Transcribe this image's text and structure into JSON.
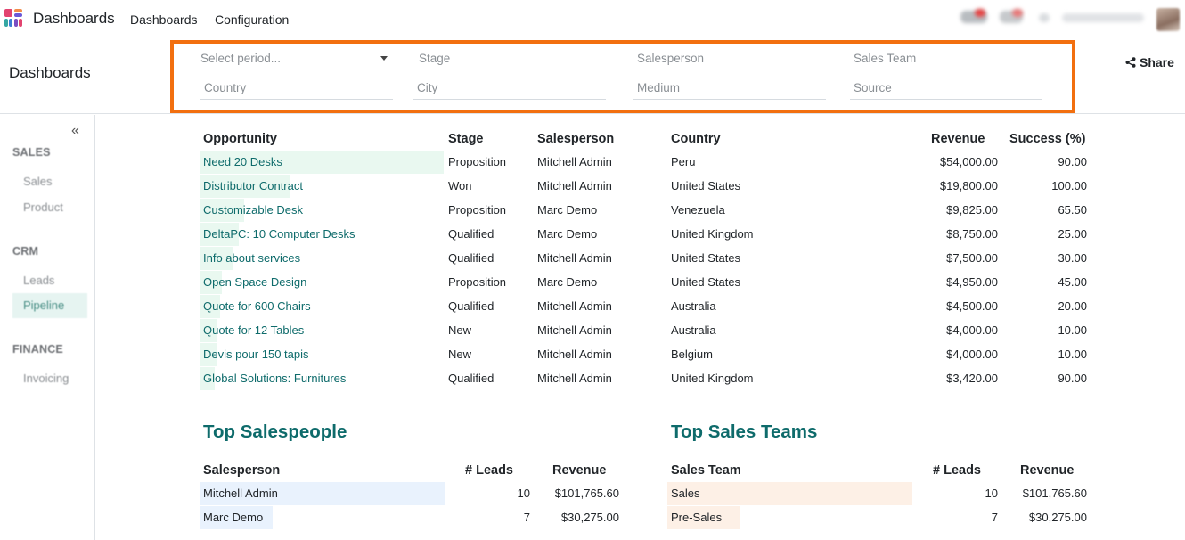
{
  "navbar": {
    "app_name": "Dashboards",
    "menus": [
      "Dashboards",
      "Configuration"
    ]
  },
  "control_panel": {
    "title": "Dashboards",
    "filters": {
      "period": "Select period...",
      "stage": "Stage",
      "salesperson": "Salesperson",
      "sales_team": "Sales Team",
      "country": "Country",
      "city": "City",
      "medium": "Medium",
      "source": "Source"
    },
    "share_label": "Share"
  },
  "sidebar": {
    "sections": [
      {
        "heading": "SALES",
        "items": [
          "Sales",
          "Product"
        ]
      },
      {
        "heading": "CRM",
        "items": [
          "Leads",
          "Pipeline"
        ]
      },
      {
        "heading": "FINANCE",
        "items": [
          "Invoicing"
        ]
      }
    ],
    "active_item": "Pipeline"
  },
  "opportunities": {
    "headers": [
      "Opportunity",
      "Stage",
      "Salesperson",
      "Country",
      "Revenue",
      "Success (%)"
    ],
    "rows": [
      {
        "name": "Need 20 Desks",
        "stage": "Proposition",
        "salesperson": "Mitchell Admin",
        "country": "Peru",
        "revenue": "$54,000.00",
        "success": "90.00",
        "share": 1.0
      },
      {
        "name": "Distributor Contract",
        "stage": "Won",
        "salesperson": "Mitchell Admin",
        "country": "United States",
        "revenue": "$19,800.00",
        "success": "100.00",
        "share": 0.367
      },
      {
        "name": "Customizable Desk",
        "stage": "Proposition",
        "salesperson": "Marc Demo",
        "country": "Venezuela",
        "revenue": "$9,825.00",
        "success": "65.50",
        "share": 0.182
      },
      {
        "name": "DeltaPC: 10 Computer Desks",
        "stage": "Qualified",
        "salesperson": "Marc Demo",
        "country": "United Kingdom",
        "revenue": "$8,750.00",
        "success": "25.00",
        "share": 0.162
      },
      {
        "name": "Info about services",
        "stage": "Qualified",
        "salesperson": "Mitchell Admin",
        "country": "United States",
        "revenue": "$7,500.00",
        "success": "30.00",
        "share": 0.139
      },
      {
        "name": "Open Space Design",
        "stage": "Proposition",
        "salesperson": "Marc Demo",
        "country": "United States",
        "revenue": "$4,950.00",
        "success": "45.00",
        "share": 0.092
      },
      {
        "name": "Quote for 600 Chairs",
        "stage": "Qualified",
        "salesperson": "Mitchell Admin",
        "country": "Australia",
        "revenue": "$4,500.00",
        "success": "20.00",
        "share": 0.083
      },
      {
        "name": "Quote for 12 Tables",
        "stage": "New",
        "salesperson": "Mitchell Admin",
        "country": "Australia",
        "revenue": "$4,000.00",
        "success": "10.00",
        "share": 0.074
      },
      {
        "name": "Devis pour 150 tapis",
        "stage": "New",
        "salesperson": "Mitchell Admin",
        "country": "Belgium",
        "revenue": "$4,000.00",
        "success": "10.00",
        "share": 0.074
      },
      {
        "name": "Global Solutions: Furnitures",
        "stage": "Qualified",
        "salesperson": "Mitchell Admin",
        "country": "United Kingdom",
        "revenue": "$3,420.00",
        "success": "90.00",
        "share": 0.063
      }
    ]
  },
  "top_salespeople": {
    "title": "Top Salespeople",
    "headers": [
      "Salesperson",
      "# Leads",
      "Revenue"
    ],
    "rows": [
      {
        "name": "Mitchell Admin",
        "leads": "10",
        "revenue": "$101,765.60",
        "share": 1.0
      },
      {
        "name": "Marc Demo",
        "leads": "7",
        "revenue": "$30,275.00",
        "share": 0.298
      }
    ]
  },
  "top_sales_teams": {
    "title": "Top Sales Teams",
    "headers": [
      "Sales Team",
      "# Leads",
      "Revenue"
    ],
    "rows": [
      {
        "name": "Sales",
        "leads": "10",
        "revenue": "$101,765.60",
        "share": 1.0
      },
      {
        "name": "Pre-Sales",
        "leads": "7",
        "revenue": "$30,275.00",
        "share": 0.298
      }
    ]
  },
  "colors": {
    "accent": "#0e6b6b",
    "highlight_border": "#f26f0f",
    "opportunity_bar": "#e9f8f0",
    "salespeople_bar": "#e9f2fd",
    "teams_bar": "#fdf0e6"
  }
}
